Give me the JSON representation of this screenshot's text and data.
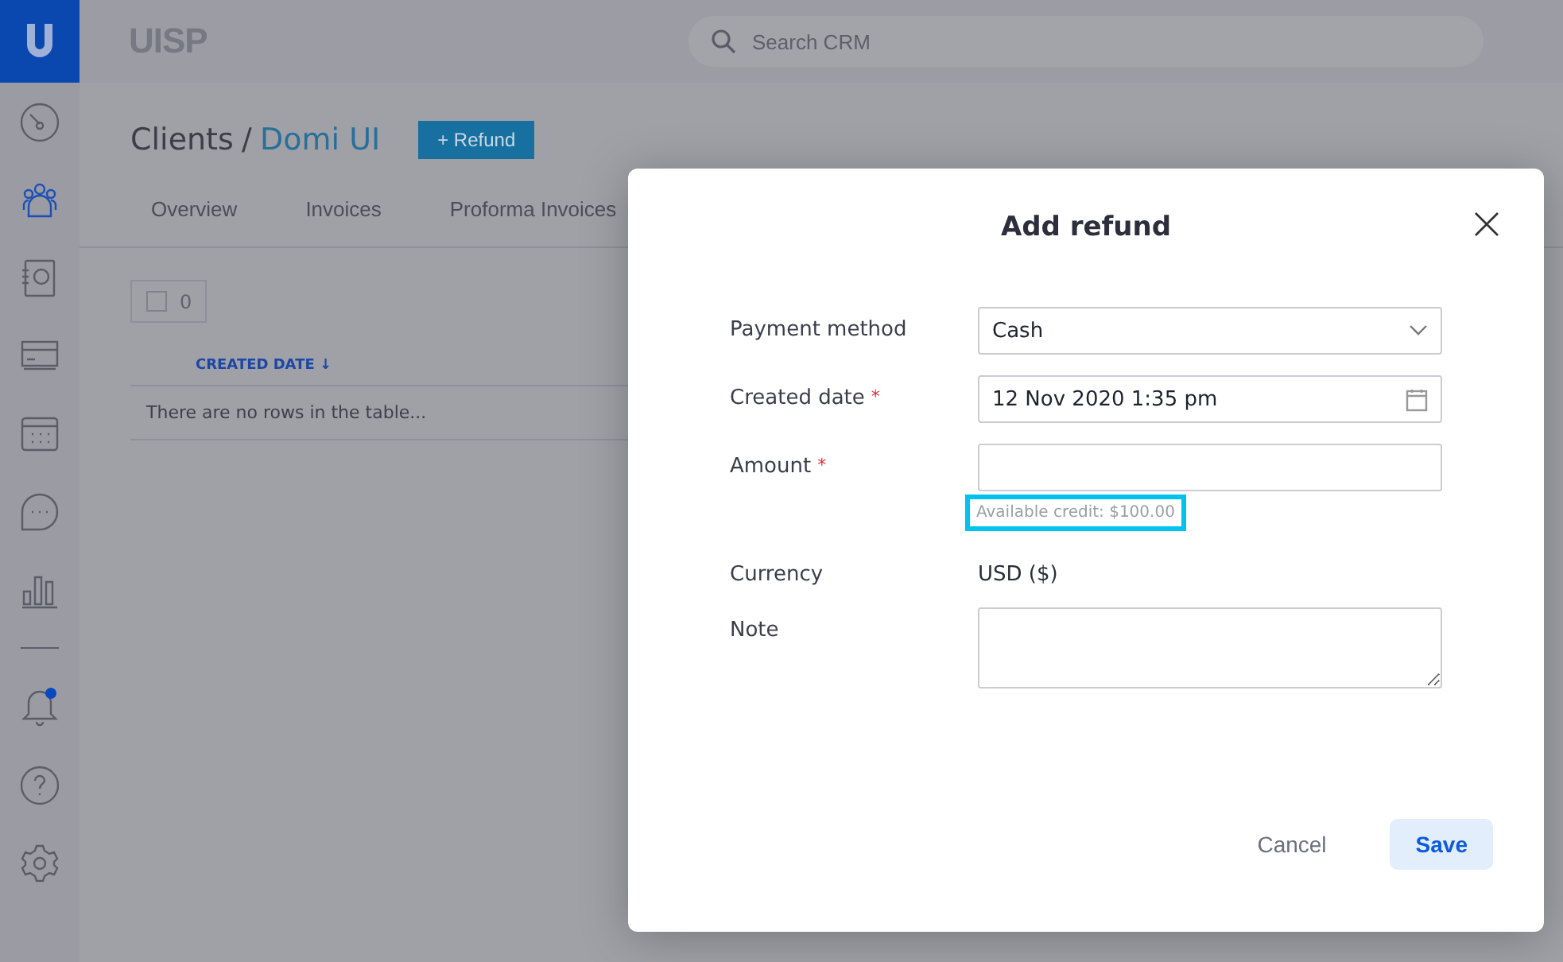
{
  "app": {
    "name": "UISP",
    "search": {
      "placeholder": "Search CRM"
    }
  },
  "page": {
    "breadcrumb": [
      "Clients",
      "/",
      "Domi UI"
    ],
    "action": "+ Refund",
    "tabs": [
      {
        "label": "Overview"
      },
      {
        "label": "Invoices"
      },
      {
        "label": "Proforma Invoices"
      }
    ],
    "selection": {
      "checked": false,
      "count": "0"
    },
    "table": {
      "columns": [
        "CREATED DATE ↓"
      ],
      "empty": "There are no rows in the table..."
    }
  },
  "notifications": {
    "unread": true
  },
  "dialog": {
    "title": "Add refund",
    "fields": [
      {
        "kind": "select",
        "label": "Payment method",
        "required": false,
        "value": "Cash"
      },
      {
        "kind": "date",
        "label": "Created date",
        "required": true,
        "value": "12 Nov 2020 1:35 pm"
      },
      {
        "kind": "input",
        "label": "Amount",
        "required": true,
        "hint": "Available credit: $100.00"
      },
      {
        "kind": "static",
        "label": "Currency",
        "required": false,
        "value": "USD ($)"
      },
      {
        "kind": "textarea",
        "label": "Note",
        "required": false
      }
    ],
    "required_mark": "*",
    "buttons": [
      {
        "label": "Cancel",
        "primary": false
      },
      {
        "label": "Save",
        "primary": true
      }
    ]
  }
}
